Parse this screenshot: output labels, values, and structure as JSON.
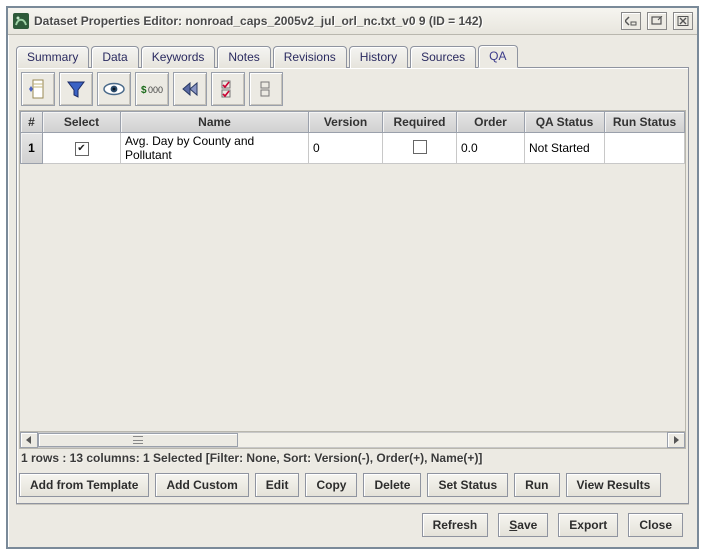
{
  "window": {
    "title": "Dataset Properties Editor: nonroad_caps_2005v2_jul_orl_nc.txt_v0 9 (ID = 142)"
  },
  "tabs": [
    "Summary",
    "Data",
    "Keywords",
    "Notes",
    "Revisions",
    "History",
    "Sources",
    "QA"
  ],
  "active_tab": "QA",
  "table": {
    "columns": [
      "#",
      "Select",
      "Name",
      "Version",
      "Required",
      "Order",
      "QA Status",
      "Run Status"
    ],
    "rows": [
      {
        "num": "1",
        "select_checked": true,
        "name": "Avg. Day by County and Pollutant",
        "version": "0",
        "required": false,
        "order": "0.0",
        "qa_status": "Not Started",
        "run_status": ""
      }
    ]
  },
  "status": "1 rows : 13 columns: 1 Selected [Filter: None, Sort: Version(-), Order(+), Name(+)]",
  "qa_buttons": {
    "add_template": "Add from Template",
    "add_custom": "Add Custom",
    "edit": "Edit",
    "copy": "Copy",
    "delete": "Delete",
    "set_status": "Set Status",
    "run": "Run",
    "view_results": "View Results"
  },
  "bottom_buttons": {
    "refresh": "Refresh",
    "save": "Save",
    "export": "Export",
    "close": "Close"
  },
  "toolbar_icons": [
    "page-icon",
    "funnel-icon",
    "eye-icon",
    "format-icon",
    "rewind-icon",
    "check-icon",
    "list-icon"
  ]
}
